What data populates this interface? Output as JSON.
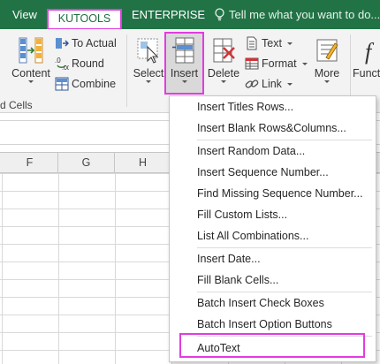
{
  "tabs": {
    "view": "View",
    "kutools": "KUTOOLS",
    "enterprise": "ENTERPRISE",
    "tell_me": "Tell me what you want to do..."
  },
  "ribbon": {
    "content": "Content",
    "to_actual": "To Actual",
    "round": "Round",
    "combine": "Combine",
    "select": "Select",
    "insert": "Insert",
    "delete": "Delete",
    "text": "Text",
    "format": "Format",
    "link": "Link",
    "more": "More",
    "functions": "Functi",
    "group_label": "d Cells"
  },
  "columns": [
    "F",
    "G",
    "H"
  ],
  "insert_menu": {
    "items": [
      "Insert Titles Rows...",
      "Insert Blank Rows&Columns...",
      "Insert Random Data...",
      "Insert Sequence Number...",
      "Find Missing Sequence Number...",
      "Fill Custom Lists...",
      "List All Combinations...",
      "Insert Date...",
      "Fill Blank Cells...",
      "Batch Insert Check Boxes",
      "Batch Insert Option Buttons",
      "AutoText"
    ]
  },
  "colors": {
    "tab_green": "#217346",
    "highlight_magenta": "#e23de0"
  }
}
